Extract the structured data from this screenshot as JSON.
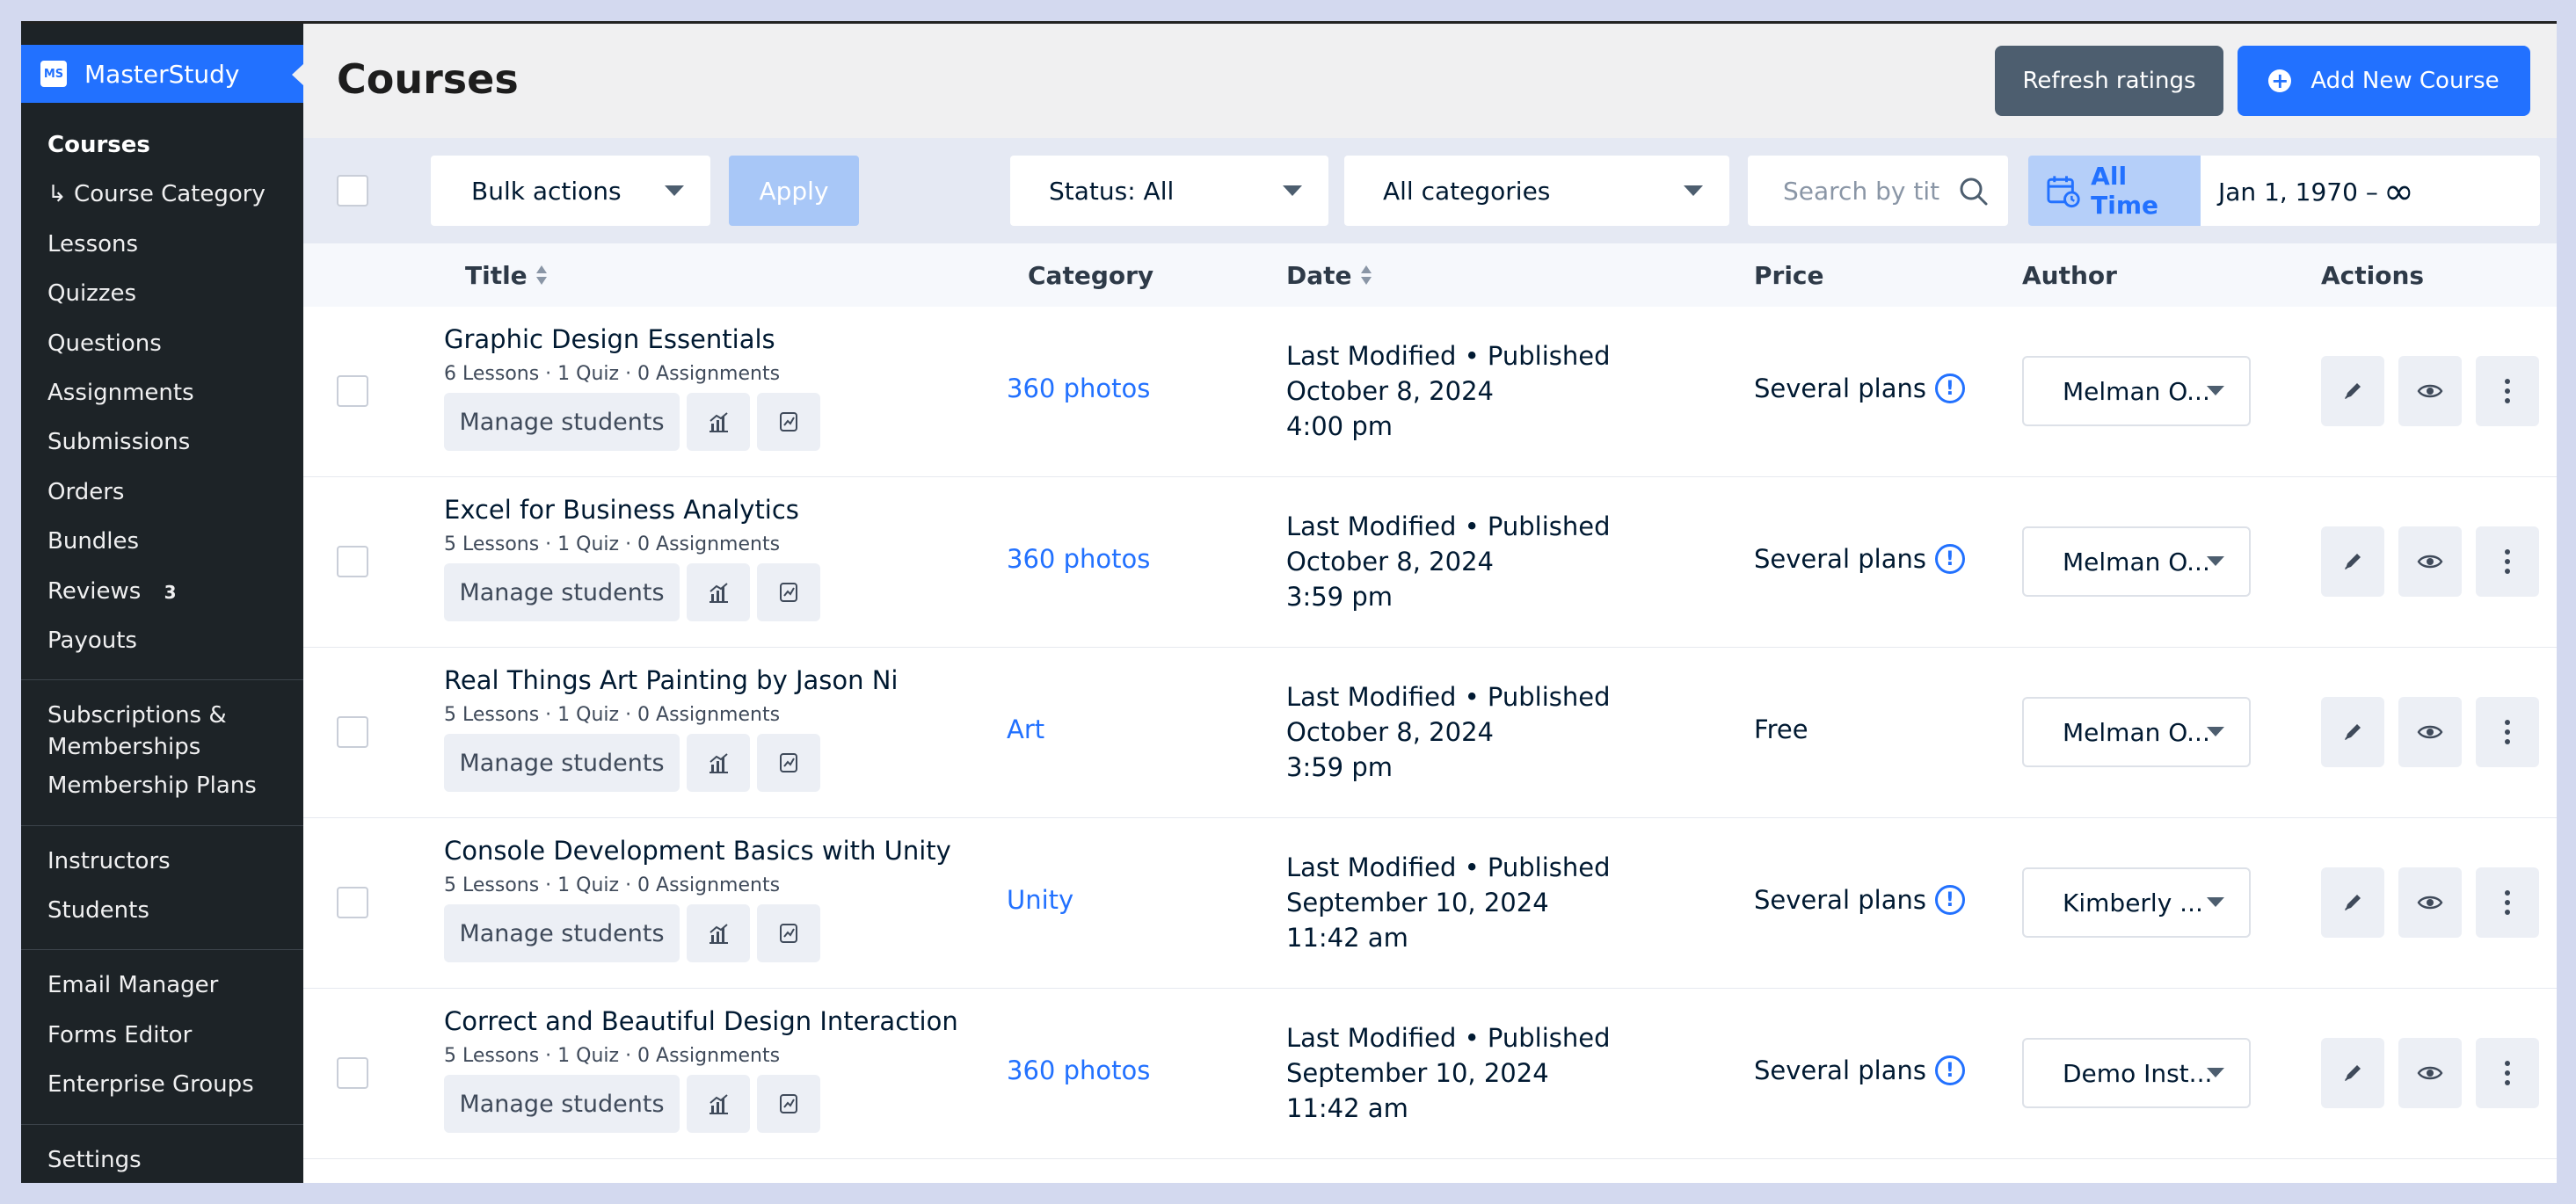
{
  "sidebar": {
    "brand": "MasterStudy",
    "brand_logo_text": "MS",
    "items": [
      {
        "label": "Courses"
      },
      {
        "label": "↳ Course Category"
      },
      {
        "label": "Lessons"
      },
      {
        "label": "Quizzes"
      },
      {
        "label": "Questions"
      },
      {
        "label": "Assignments"
      },
      {
        "label": "Submissions"
      },
      {
        "label": "Orders"
      },
      {
        "label": "Bundles"
      },
      {
        "label": "Reviews",
        "badge": "3"
      },
      {
        "label": "Payouts"
      },
      {
        "label": "Subscriptions & Memberships"
      },
      {
        "label": "Membership Plans"
      },
      {
        "label": "Instructors"
      },
      {
        "label": "Students"
      },
      {
        "label": "Email Manager"
      },
      {
        "label": "Forms Editor"
      },
      {
        "label": "Enterprise Groups"
      },
      {
        "label": "Settings"
      }
    ]
  },
  "header": {
    "title": "Courses",
    "refresh_label": "Refresh ratings",
    "add_label": "Add New Course"
  },
  "toolbar": {
    "bulk_label": "Bulk actions",
    "apply_label": "Apply",
    "status_label": "Status: All",
    "categories_label": "All categories",
    "search_placeholder": "Search by title",
    "all_time_label": "All Time",
    "date_range": "Jan 1, 1970 –",
    "infinity": "∞"
  },
  "table": {
    "headers": {
      "title": "Title",
      "category": "Category",
      "date": "Date",
      "price": "Price",
      "author": "Author",
      "actions": "Actions"
    },
    "manage_label": "Manage students",
    "rows": [
      {
        "title": "Graphic Design Essentials",
        "meta": "6 Lessons · 1 Quiz · 0 Assignments",
        "category": "360 photos",
        "status": "Last Modified • Published",
        "date": "October 8, 2024",
        "time": "4:00 pm",
        "price": "Several plans",
        "author": "Melman O..."
      },
      {
        "title": "Excel for Business Analytics",
        "meta": "5 Lessons · 1 Quiz · 0 Assignments",
        "category": "360 photos",
        "status": "Last Modified • Published",
        "date": "October 8, 2024",
        "time": "3:59 pm",
        "price": "Several plans",
        "author": "Melman O..."
      },
      {
        "title": "Real Things Art Painting by Jason Ni",
        "meta": "5 Lessons · 1 Quiz · 0 Assignments",
        "category": "Art",
        "status": "Last Modified • Published",
        "date": "October 8, 2024",
        "time": "3:59 pm",
        "price": "Free",
        "author": "Melman O..."
      },
      {
        "title": "Console Development Basics with Unity",
        "meta": "5 Lessons · 1 Quiz · 0 Assignments",
        "category": "Unity",
        "status": "Last Modified • Published",
        "date": "September 10, 2024",
        "time": "11:42 am",
        "price": "Several plans",
        "author": "Kimberly ..."
      },
      {
        "title": "Correct and Beautiful Design Interaction",
        "meta": "5 Lessons · 1 Quiz · 0 Assignments",
        "category": "360 photos",
        "status": "Last Modified • Published",
        "date": "September 10, 2024",
        "time": "11:42 am",
        "price": "Several plans",
        "author": "Demo Inst..."
      }
    ]
  },
  "colors": {
    "accent": "#2271ff",
    "sidebar_bg": "#1d2327",
    "refresh_bg": "#4d5e6f"
  }
}
